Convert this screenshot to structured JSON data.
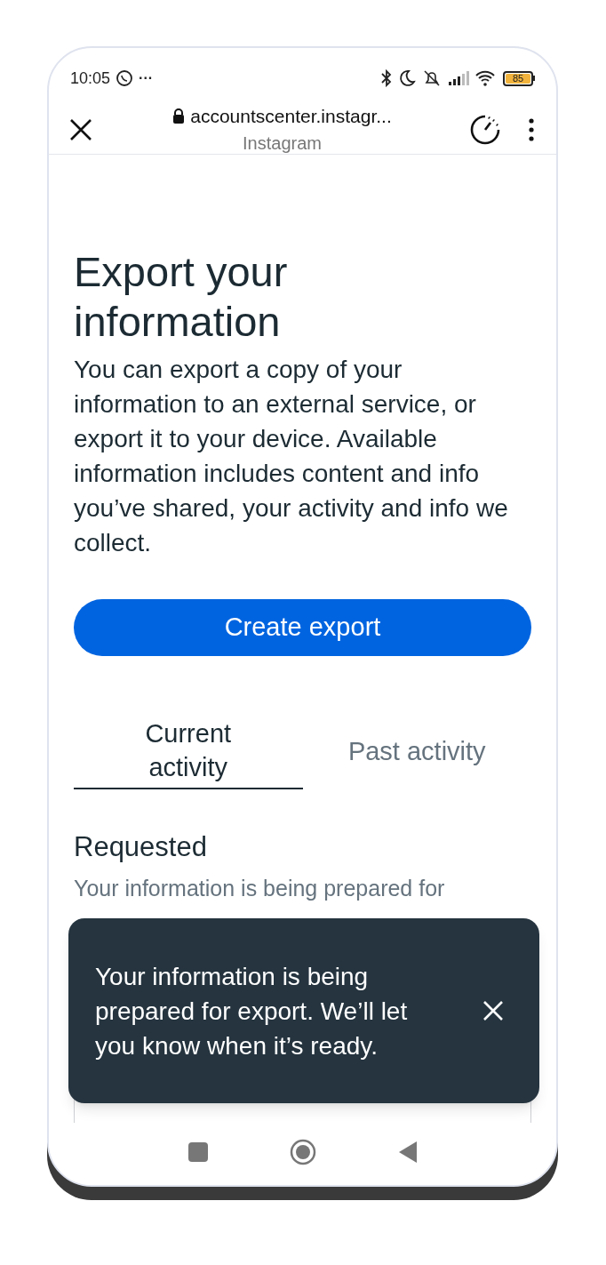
{
  "status_bar": {
    "time": "10:05",
    "dots": "···",
    "battery": "85"
  },
  "browser_bar": {
    "url": "accountscenter.instagr...",
    "site": "Instagram"
  },
  "page": {
    "title": "Export your information",
    "description": "You can export a copy of your information to an external service, or export it to your device. Available information includes content and info you’ve shared, your activity and info we collect.",
    "primary_button": "Create export",
    "tabs": [
      {
        "label": "Current activity",
        "selected": true
      },
      {
        "label": "Past activity",
        "selected": false
      }
    ],
    "section_title": "Requested",
    "section_text": "Your information is being prepared for"
  },
  "toast": {
    "message": "Your information is being prepared for export. We’ll let you know when it’s ready."
  }
}
